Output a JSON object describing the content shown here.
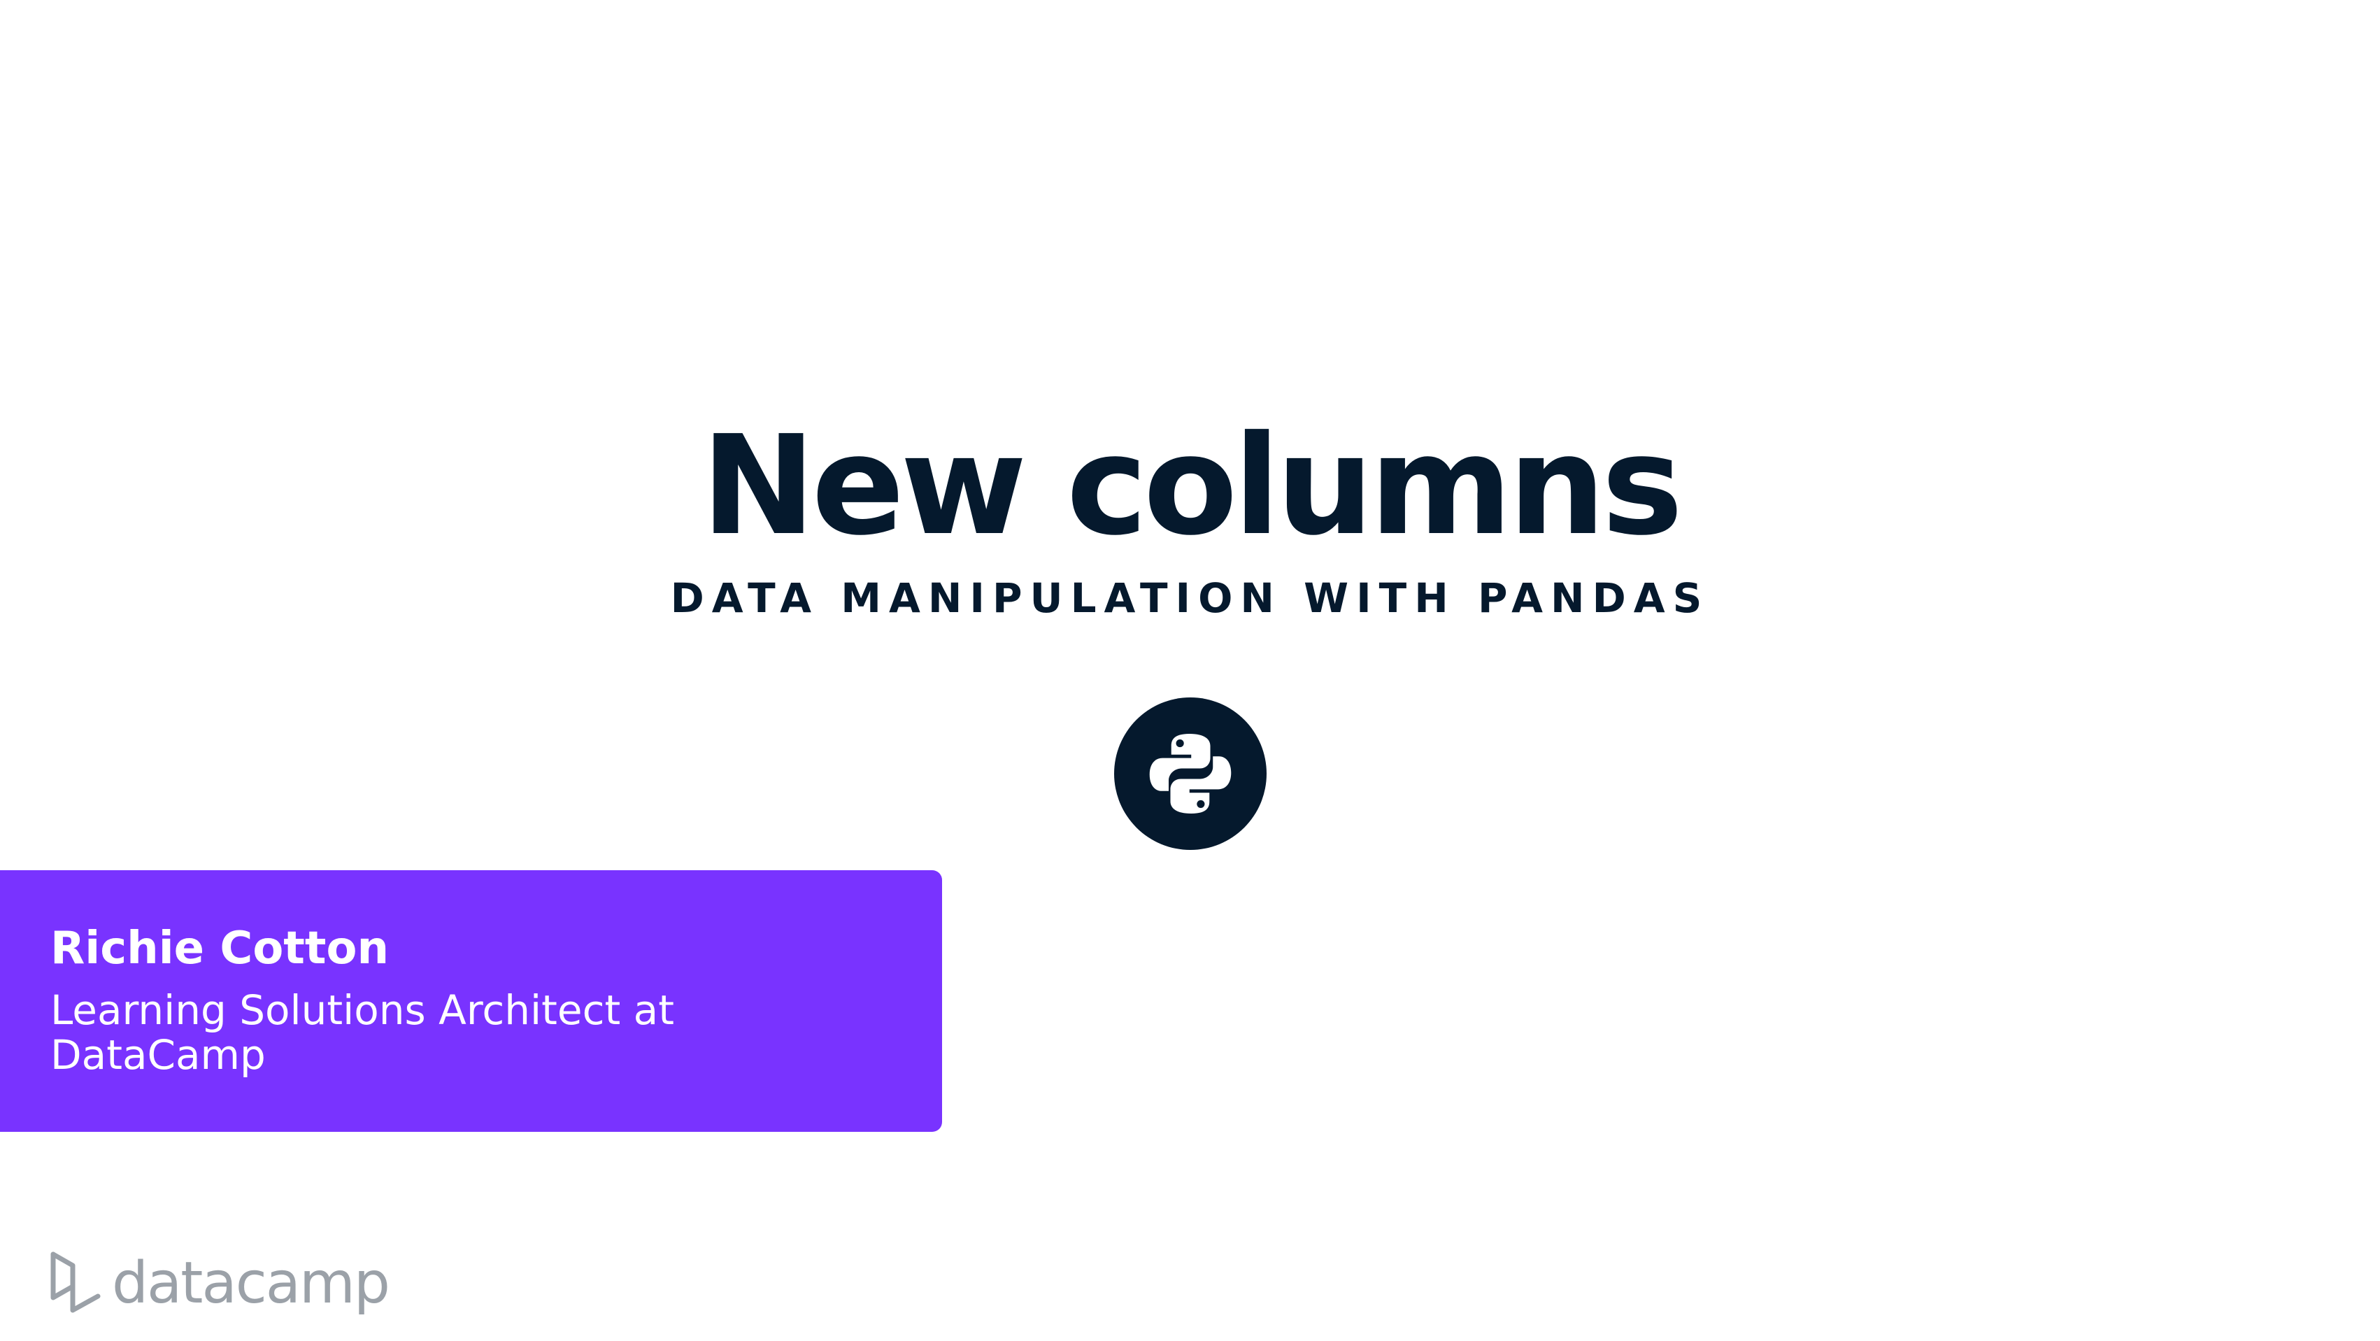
{
  "slide": {
    "title": "New columns",
    "course_title": "DATA MANIPULATION WITH PANDAS",
    "language_icon": "python-icon"
  },
  "author": {
    "name": "Richie Cotton",
    "role": "Learning Solutions Architect at DataCamp"
  },
  "brand": {
    "wordmark": "datacamp",
    "icon": "datacamp-logo-icon"
  },
  "colors": {
    "text_dark": "#05192d",
    "accent_purple": "#7933ff",
    "brand_gray": "#9ba1a8",
    "background": "#ffffff"
  }
}
